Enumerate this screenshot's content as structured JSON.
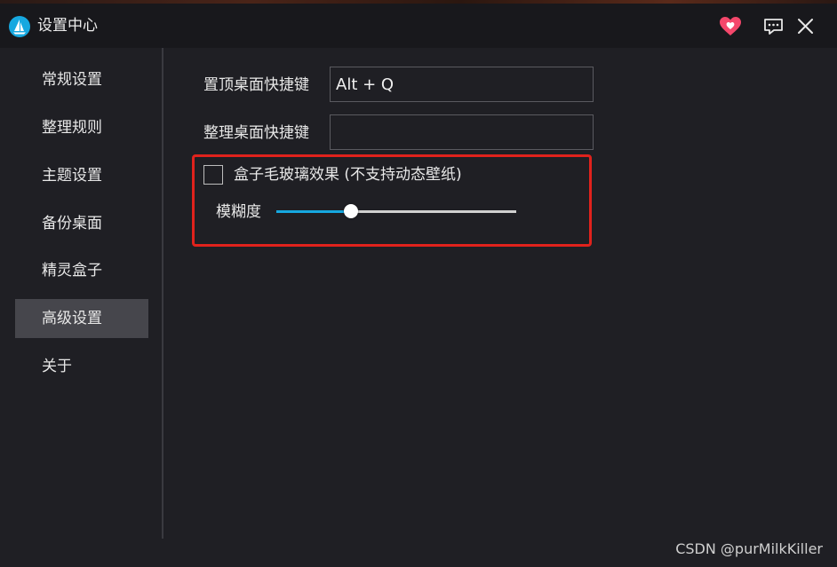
{
  "window": {
    "title": "设置中心"
  },
  "titlebar": {
    "icons": [
      "app-logo-icon",
      "heart-icon",
      "chat-icon",
      "close-icon"
    ],
    "heart_color": "#f4476b"
  },
  "sidebar": {
    "items": [
      {
        "label": "常规设置",
        "active": false
      },
      {
        "label": "整理规则",
        "active": false
      },
      {
        "label": "主题设置",
        "active": false
      },
      {
        "label": "备份桌面",
        "active": false
      },
      {
        "label": "精灵盒子",
        "active": false
      },
      {
        "label": "高级设置",
        "active": true
      },
      {
        "label": "关于",
        "active": false
      }
    ]
  },
  "settings": {
    "pin_hotkey": {
      "label": "置顶桌面快捷键",
      "value": "Alt + Q"
    },
    "organize_hotkey": {
      "label": "整理桌面快捷键",
      "value": ""
    },
    "glass_effect": {
      "label": "盒子毛玻璃效果 (不支持动态壁纸)",
      "checked": false
    },
    "blur": {
      "label": "模糊度",
      "level_fraction": 0.31
    }
  },
  "colors": {
    "accent": "#16a8e0",
    "highlight_border": "#e0221c",
    "background": "#1f1f24",
    "titlebar": "#18181c",
    "active_nav": "#46464c"
  },
  "watermark": "CSDN @purMilkKiller"
}
